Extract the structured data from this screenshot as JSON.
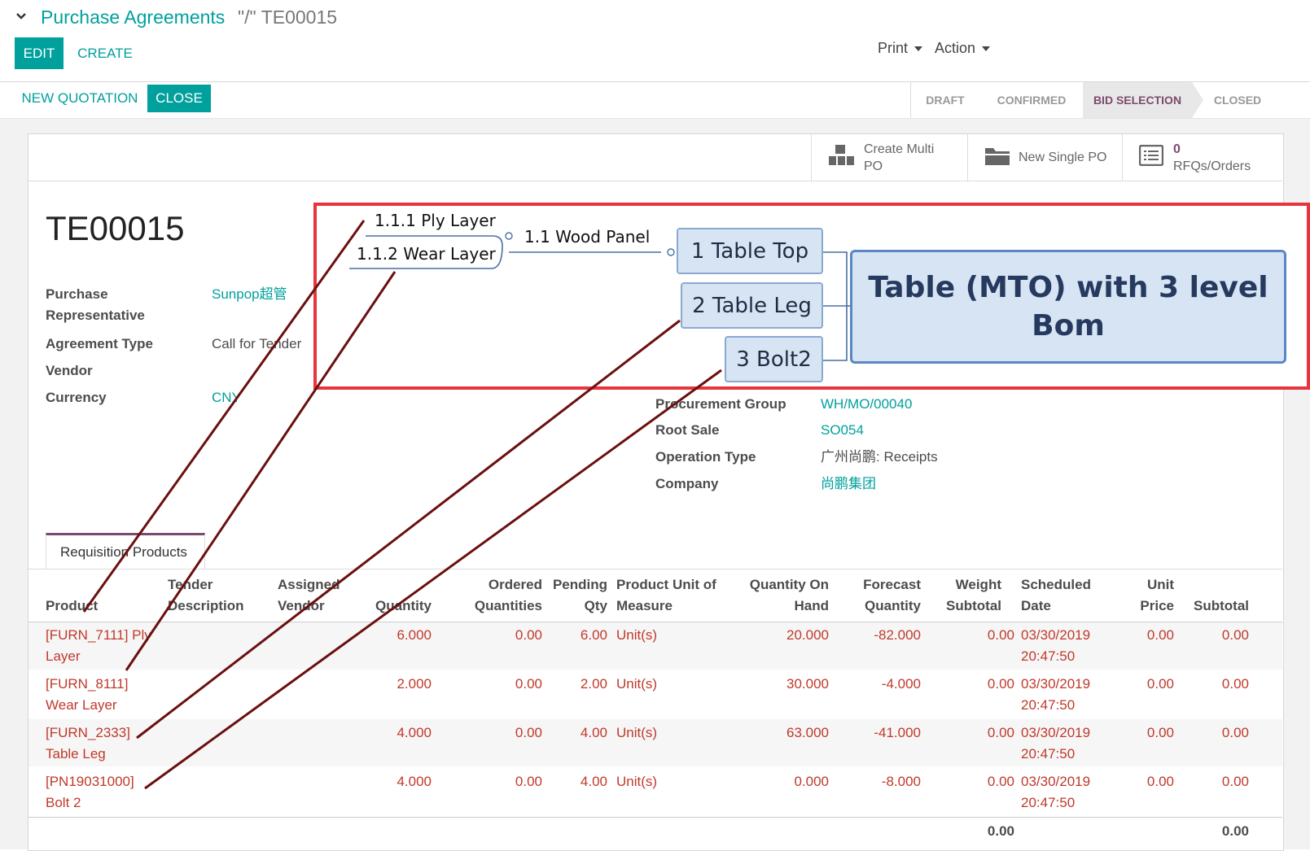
{
  "breadcrumb": {
    "parent": "Purchase Agreements",
    "current": "\"/\" TE00015"
  },
  "toolbar": {
    "edit": "EDIT",
    "create": "CREATE",
    "print": "Print",
    "action": "Action"
  },
  "header_buttons": {
    "new_quotation": "NEW QUOTATION",
    "close": "CLOSE"
  },
  "stages": [
    "DRAFT",
    "CONFIRMED",
    "BID SELECTION",
    "CLOSED"
  ],
  "active_stage": "BID SELECTION",
  "smart_buttons": {
    "create_multi_po": "Create Multi PO",
    "create_multi_po_l1": "Create Multi",
    "create_multi_po_l2": "PO",
    "new_single_po": "New Single PO",
    "rfq_count": "0",
    "rfq_label": "RFQs/Orders"
  },
  "record": {
    "name": "TE00015",
    "fields_left": [
      {
        "label": "Purchase Representative",
        "label_l1": "Purchase",
        "label_l2": "Representative",
        "value": "Sunpop超管"
      },
      {
        "label": "Agreement Type",
        "value": "Call for Tender"
      },
      {
        "label": "Vendor",
        "value": ""
      },
      {
        "label": "Currency",
        "value": "CNY"
      }
    ],
    "fields_right": [
      {
        "label": "Procurement Group",
        "value": "WH/MO/00040"
      },
      {
        "label": "Root Sale",
        "value": "SO054"
      },
      {
        "label": "Operation Type",
        "value": "广州尚鹏: Receipts"
      },
      {
        "label": "Company",
        "value": "尚鹏集团"
      }
    ]
  },
  "tabs": {
    "requisition_products": "Requisition Products"
  },
  "table": {
    "headers": {
      "product": "Product",
      "tender_description_l1": "Tender",
      "tender_description_l2": "Description",
      "assigned_vendor_l1": "Assigned",
      "assigned_vendor_l2": "Vendor",
      "quantity": "Quantity",
      "ordered_l1": "Ordered",
      "ordered_l2": "Quantities",
      "pending_l1": "Pending",
      "pending_l2": "Qty",
      "uom_l1": "Product Unit of",
      "uom_l2": "Measure",
      "onhand_l1": "Quantity On",
      "onhand_l2": "Hand",
      "forecast_l1": "Forecast",
      "forecast_l2": "Quantity",
      "weight_l1": "Weight",
      "weight_l2": "Subtotal",
      "scheduled_l1": "Scheduled",
      "scheduled_l2": "Date",
      "unit_price_l1": "Unit",
      "unit_price_l2": "Price",
      "subtotal": "Subtotal"
    },
    "rows": [
      {
        "product_l1": "[FURN_7111] Ply",
        "product_l2": "Layer",
        "quantity": "6.000",
        "ordered": "0.00",
        "pending": "6.00",
        "uom": "Unit(s)",
        "onhand": "20.000",
        "forecast": "-82.000",
        "weight": "0.00",
        "date_l1": "03/30/2019",
        "date_l2": "20:47:50",
        "unit_price": "0.00",
        "subtotal": "0.00"
      },
      {
        "product_l1": "[FURN_8111]",
        "product_l2": "Wear Layer",
        "quantity": "2.000",
        "ordered": "0.00",
        "pending": "2.00",
        "uom": "Unit(s)",
        "onhand": "30.000",
        "forecast": "-4.000",
        "weight": "0.00",
        "date_l1": "03/30/2019",
        "date_l2": "20:47:50",
        "unit_price": "0.00",
        "subtotal": "0.00"
      },
      {
        "product_l1": "[FURN_2333]",
        "product_l2": "Table Leg",
        "quantity": "4.000",
        "ordered": "0.00",
        "pending": "4.00",
        "uom": "Unit(s)",
        "onhand": "63.000",
        "forecast": "-41.000",
        "weight": "0.00",
        "date_l1": "03/30/2019",
        "date_l2": "20:47:50",
        "unit_price": "0.00",
        "subtotal": "0.00"
      },
      {
        "product_l1": "[PN19031000]",
        "product_l2": "Bolt 2",
        "quantity": "4.000",
        "ordered": "0.00",
        "pending": "4.00",
        "uom": "Unit(s)",
        "onhand": "0.000",
        "forecast": "-8.000",
        "weight": "0.00",
        "date_l1": "03/30/2019",
        "date_l2": "20:47:50",
        "unit_price": "0.00",
        "subtotal": "0.00"
      }
    ],
    "totals": {
      "weight": "0.00",
      "subtotal": "0.00"
    }
  },
  "annotation": {
    "title": "Table (MTO) with 3 level Bom",
    "title_l1": "Table (MTO) with 3 level",
    "title_l2": "Bom",
    "nodes": {
      "top": "1 Table Top",
      "leg": "2 Table Leg",
      "bolt": "3 Bolt2",
      "wood_panel": "1.1 Wood Panel",
      "ply_layer": "1.1.1 Ply Layer",
      "wear_layer": "1.1.2 Wear Layer"
    },
    "colors": {
      "frame": "#e8343c",
      "node_fill": "#d6e4f3",
      "node_border": "#8aa9d0",
      "leader_lines": "#6b0f0f"
    }
  },
  "colors": {
    "primary": "#00A09D",
    "danger": "#c0392b",
    "active_stage": "#7c4a6e"
  }
}
